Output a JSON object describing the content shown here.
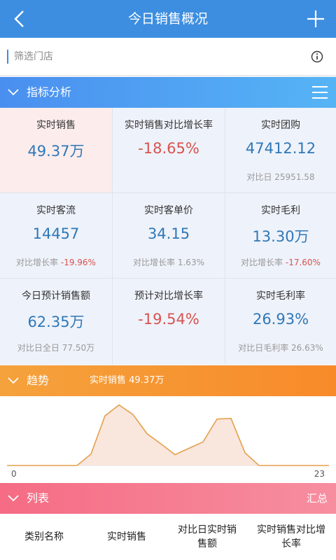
{
  "nav": {
    "title": "今日销售概况"
  },
  "filter": {
    "placeholder": "筛选门店"
  },
  "indicators": {
    "title": "指标分析",
    "cells": [
      {
        "label": "实时销售",
        "value": "49.37万",
        "sub_prefix": "",
        "sub_value": "",
        "highlight": true
      },
      {
        "label": "实时销售对比增长率",
        "value": "-18.65%",
        "sub_prefix": "",
        "sub_value": ""
      },
      {
        "label": "实时团购",
        "value": "47412.12",
        "sub_prefix": "对比日",
        "sub_value": "25951.58"
      },
      {
        "label": "实时客流",
        "value": "14457",
        "sub_prefix": "对比增长率",
        "sub_value": "-19.96%"
      },
      {
        "label": "实时客单价",
        "value": "34.15",
        "sub_prefix": "对比增长率",
        "sub_value": "1.63%"
      },
      {
        "label": "实时毛利",
        "value": "13.30万",
        "sub_prefix": "对比增长率",
        "sub_value": "-17.60%"
      },
      {
        "label": "今日预计销售额",
        "value": "62.35万",
        "sub_prefix": "对比日全日",
        "sub_value": "77.50万"
      },
      {
        "label": "预计对比增长率",
        "value": "-19.54%",
        "sub_prefix": "",
        "sub_value": ""
      },
      {
        "label": "实时毛利率",
        "value": "26.93%",
        "sub_prefix": "对比日毛利率",
        "sub_value": "26.63%"
      }
    ]
  },
  "trend": {
    "title": "趋势",
    "subtitle": "实时销售 49.37万",
    "x_start": "0",
    "x_end": "23"
  },
  "chart_data": {
    "type": "area",
    "x": [
      0,
      1,
      2,
      3,
      4,
      5,
      6,
      7,
      8,
      9,
      10,
      11,
      12,
      13,
      14,
      15,
      16,
      17,
      18,
      19,
      20,
      21,
      22,
      23
    ],
    "values": [
      0,
      0,
      0,
      0,
      0,
      0,
      0.18,
      0.78,
      0.95,
      0.8,
      0.5,
      0.34,
      0.17,
      0.27,
      0.37,
      0.73,
      0.74,
      0.2,
      0,
      0,
      0,
      0,
      0,
      0
    ],
    "xlim": [
      0,
      23
    ],
    "color": "#e3a04c",
    "fill": "#f9e6dd"
  },
  "list": {
    "title": "列表",
    "summary_label": "汇总",
    "columns": [
      "类别名称",
      "实时销售",
      "对比日实时销售额",
      "实时销售对比增长率"
    ]
  },
  "colors": {
    "nav": "#3d8ee0",
    "value_blue": "#2f78b8",
    "value_red": "#d9534f"
  }
}
